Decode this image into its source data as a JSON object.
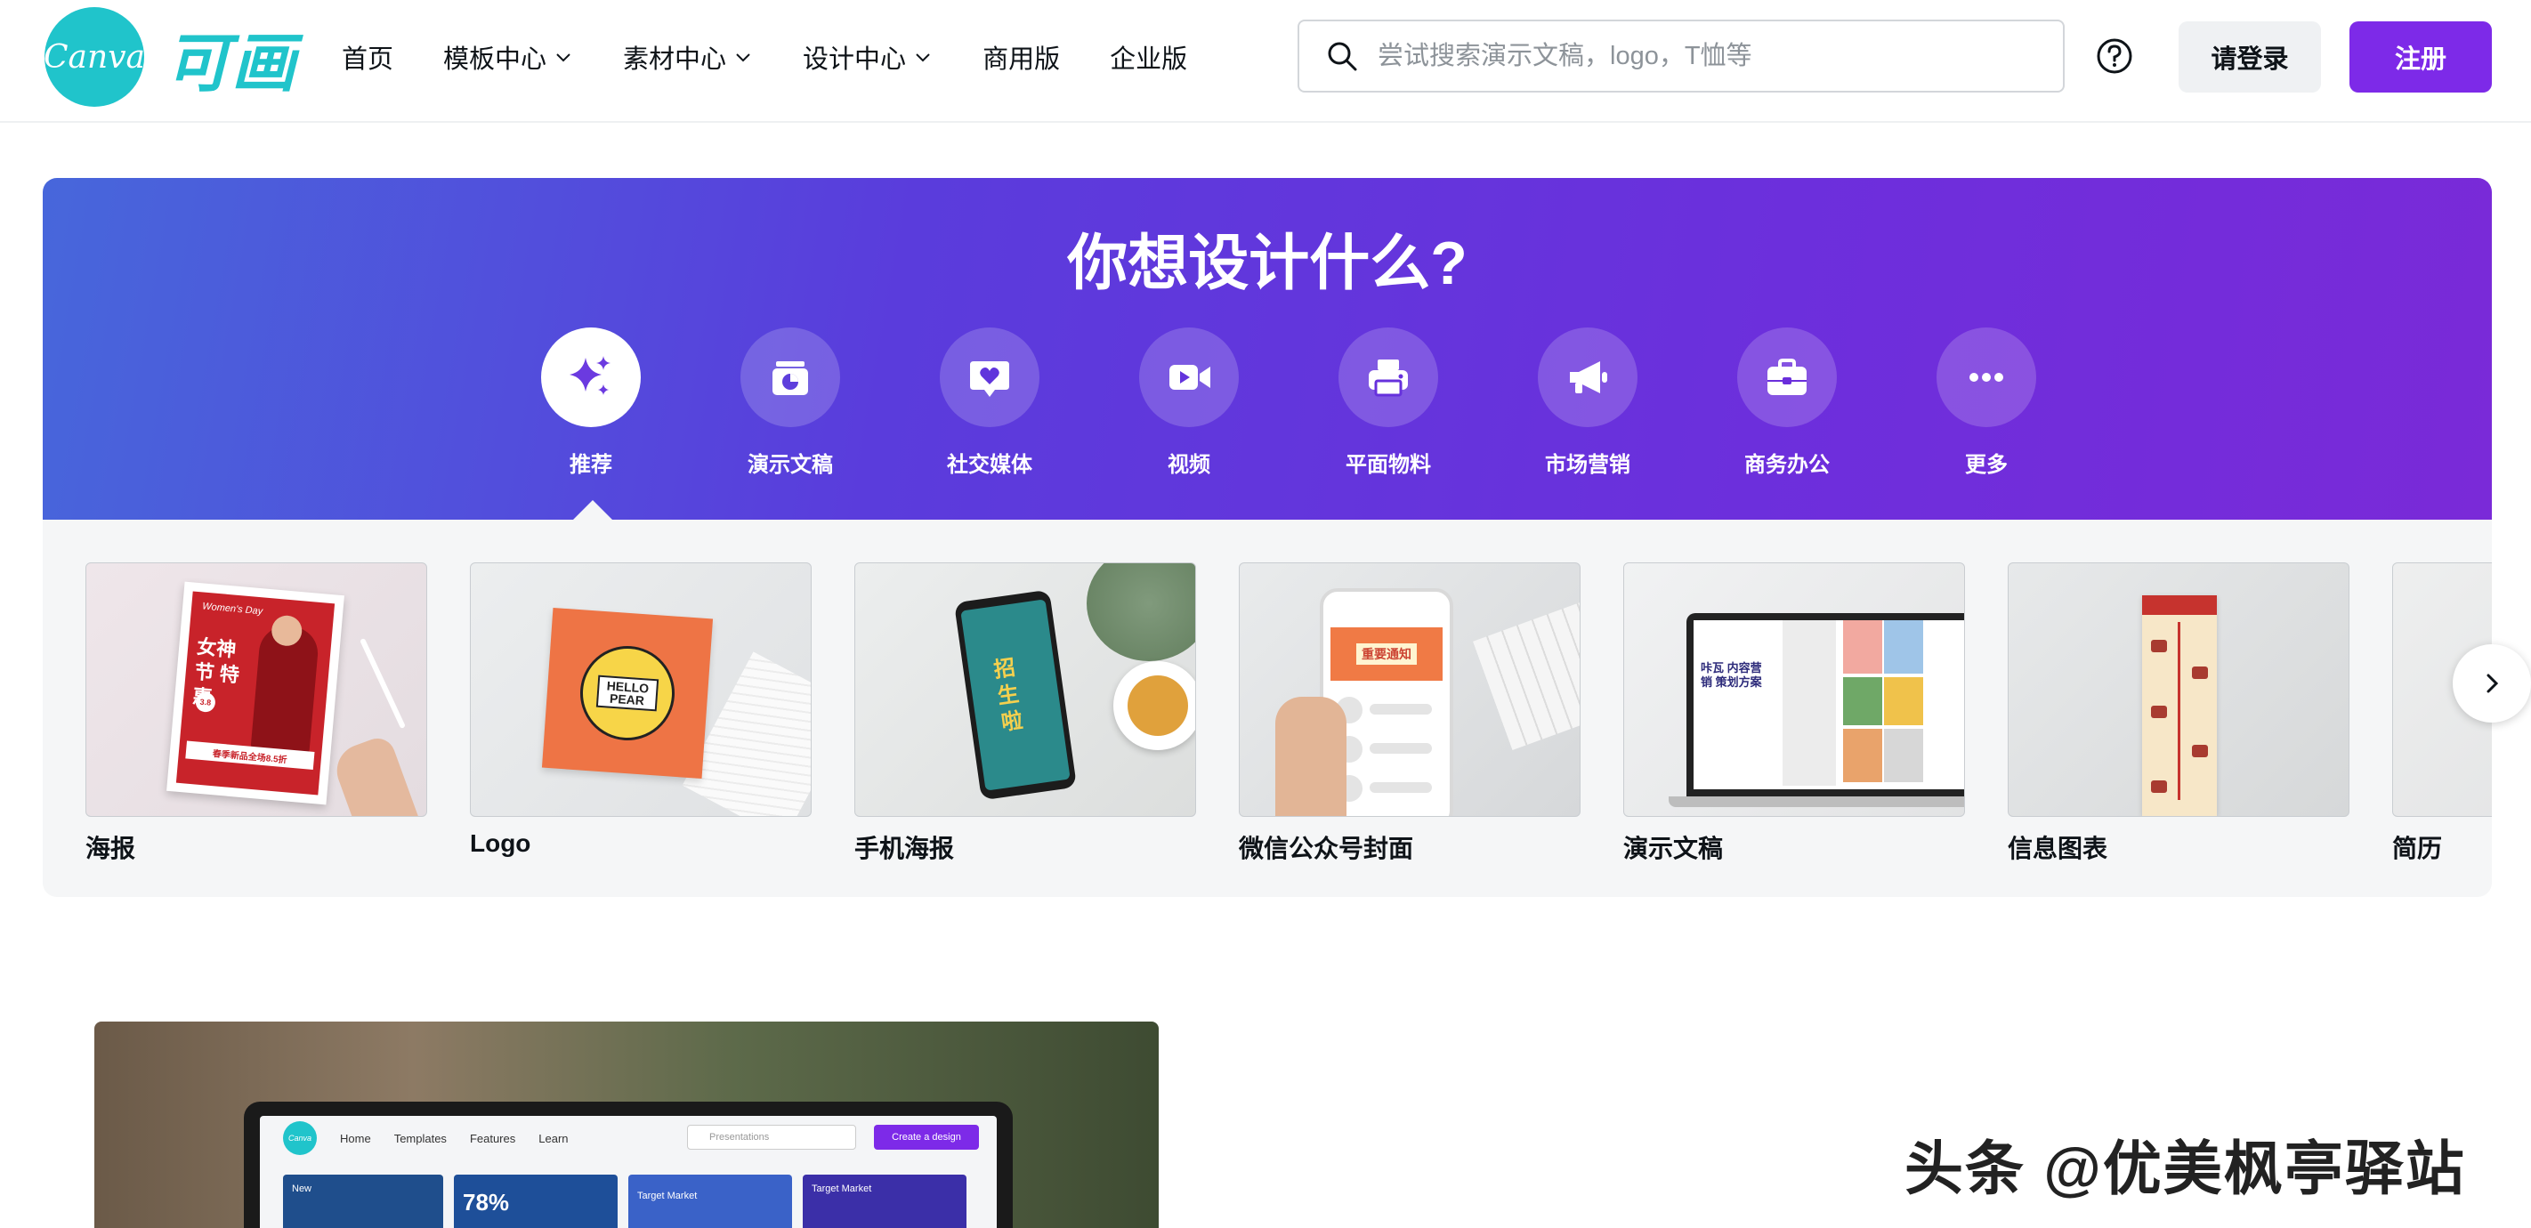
{
  "header": {
    "logo_text": "Canva",
    "logo_cn": "可画",
    "nav": [
      {
        "label": "首页",
        "dropdown": false
      },
      {
        "label": "模板中心",
        "dropdown": true
      },
      {
        "label": "素材中心",
        "dropdown": true
      },
      {
        "label": "设计中心",
        "dropdown": true
      },
      {
        "label": "商用版",
        "dropdown": false
      },
      {
        "label": "企业版",
        "dropdown": false
      }
    ],
    "search_placeholder": "尝试搜索演示文稿，logo，T恤等",
    "login_label": "请登录",
    "signup_label": "注册"
  },
  "hero": {
    "title": "你想设计什么?",
    "categories": [
      {
        "label": "推荐",
        "icon": "sparkle-icon",
        "active": true
      },
      {
        "label": "演示文稿",
        "icon": "presentation-icon",
        "active": false
      },
      {
        "label": "社交媒体",
        "icon": "heart-chat-icon",
        "active": false
      },
      {
        "label": "视频",
        "icon": "video-camera-icon",
        "active": false
      },
      {
        "label": "平面物料",
        "icon": "printer-icon",
        "active": false
      },
      {
        "label": "市场营销",
        "icon": "megaphone-icon",
        "active": false
      },
      {
        "label": "商务办公",
        "icon": "briefcase-icon",
        "active": false
      },
      {
        "label": "更多",
        "icon": "more-dots-icon",
        "active": false
      }
    ]
  },
  "cards": [
    {
      "label": "海报"
    },
    {
      "label": "Logo"
    },
    {
      "label": "手机海报"
    },
    {
      "label": "微信公众号封面"
    },
    {
      "label": "演示文稿"
    },
    {
      "label": "信息图表"
    },
    {
      "label": "简历"
    }
  ],
  "thumb_text": {
    "poster_title": "女神节 特惠",
    "poster_en": "Women's Day",
    "poster_badge": "3.8",
    "poster_footer": "春季新品全场8.5折",
    "logo_text": "HELLO PEAR",
    "mobile_text": "招生啦",
    "wechat_text": "重要通知",
    "slides_text": "咔瓦 内容营销 策划方案"
  },
  "preview": {
    "nav": [
      "Home",
      "Templates",
      "Features",
      "Learn"
    ],
    "search_placeholder": "Presentations",
    "cta": "Create a design",
    "percent": "78%",
    "card_labels": [
      "New",
      "Target Market",
      "Target Market"
    ]
  },
  "watermark": "头条 @优美枫亭驿站",
  "colors": {
    "brand_teal": "#20c4cb",
    "brand_purple": "#7d2ae8",
    "hero_gradient_start": "#4767db",
    "hero_gradient_end": "#7a2ad8"
  }
}
